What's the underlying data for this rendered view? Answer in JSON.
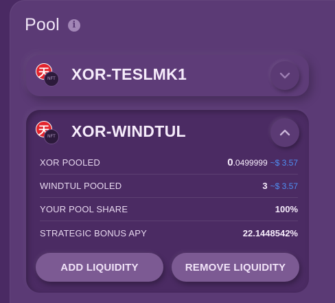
{
  "pool": {
    "title": "Pool",
    "info_icon": "i"
  },
  "pairs": [
    {
      "name": "XOR-TESLMK1",
      "token_a_glyph": "天",
      "token_b_glyph": "NFT",
      "expanded": false
    },
    {
      "name": "XOR-WINDTUL",
      "token_a_glyph": "天",
      "token_b_glyph": "NFT",
      "expanded": true,
      "rows": [
        {
          "label": "XOR POOLED",
          "value_big": "0",
          "value_small": ".0499999",
          "usd": "~$ 3.57"
        },
        {
          "label": "WINDTUL POOLED",
          "value_big": "3",
          "value_small": "",
          "usd": "~$ 3.57"
        },
        {
          "label": "YOUR POOL SHARE",
          "value_big": "100%",
          "value_small": "",
          "usd": ""
        },
        {
          "label": "STRATEGIC BONUS APY",
          "value_big": "22.1448542%",
          "value_small": "",
          "usd": ""
        }
      ],
      "add_liquidity_label": "ADD LIQUIDITY",
      "remove_liquidity_label": "REMOVE LIQUIDITY"
    }
  ],
  "colors": {
    "background": "#4a2a63",
    "accent_usd": "#4f8ff3",
    "xor_red": "#e3232c"
  },
  "icons": {
    "info": "info-icon",
    "chevron_down": "chevron-down-icon",
    "chevron_up": "chevron-up-icon",
    "xor": "xor-token-icon",
    "nft": "nft-token-icon"
  }
}
